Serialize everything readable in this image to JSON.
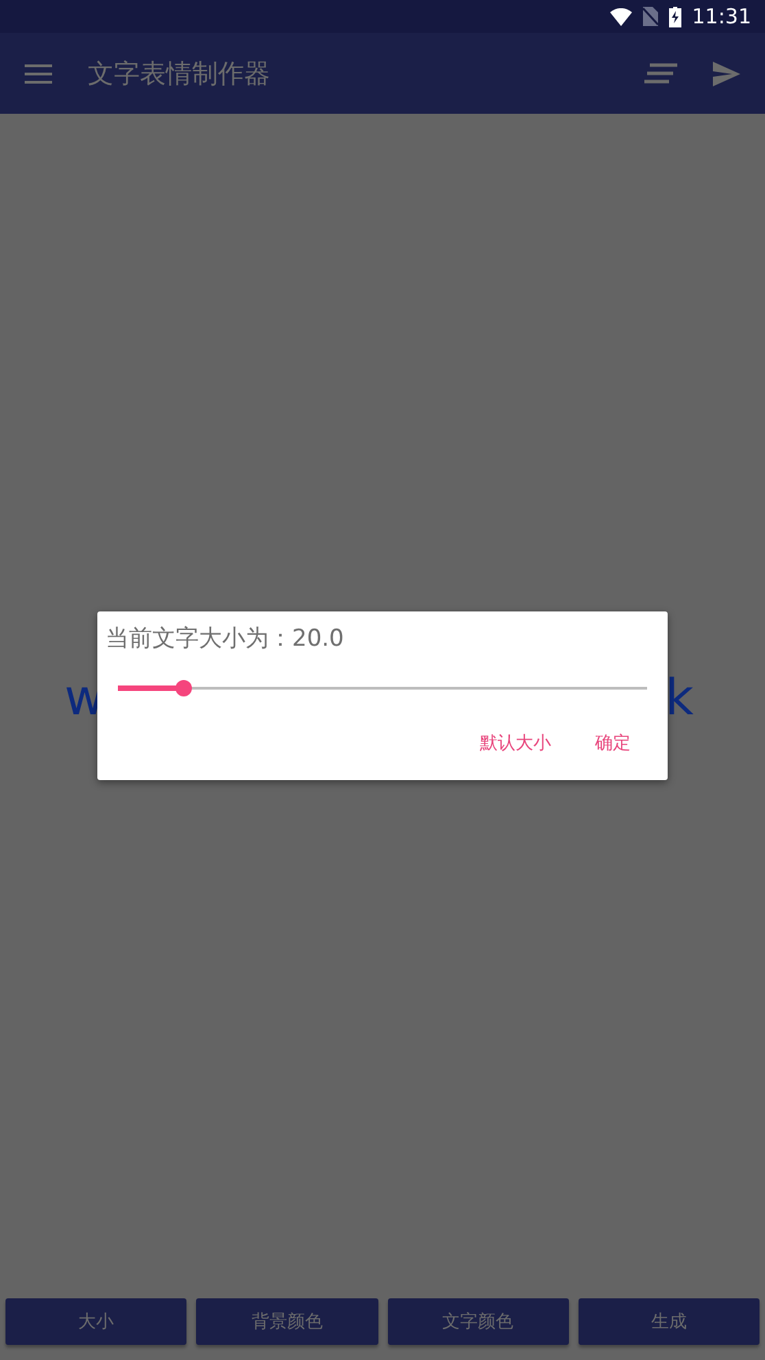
{
  "status_bar": {
    "time": "11:31"
  },
  "app_bar": {
    "title": "文字表情制作器"
  },
  "preview": {
    "text_left": "w",
    "text_right": "k"
  },
  "dialog": {
    "title": "当前文字大小为：20.0",
    "slider": {
      "level": 0.124
    },
    "buttons": [
      {
        "label": "默认大小"
      },
      {
        "label": "确定"
      }
    ]
  },
  "bottom_buttons": [
    {
      "label": "大小"
    },
    {
      "label": "背景颜色"
    },
    {
      "label": "文字颜色"
    },
    {
      "label": "生成"
    }
  ]
}
